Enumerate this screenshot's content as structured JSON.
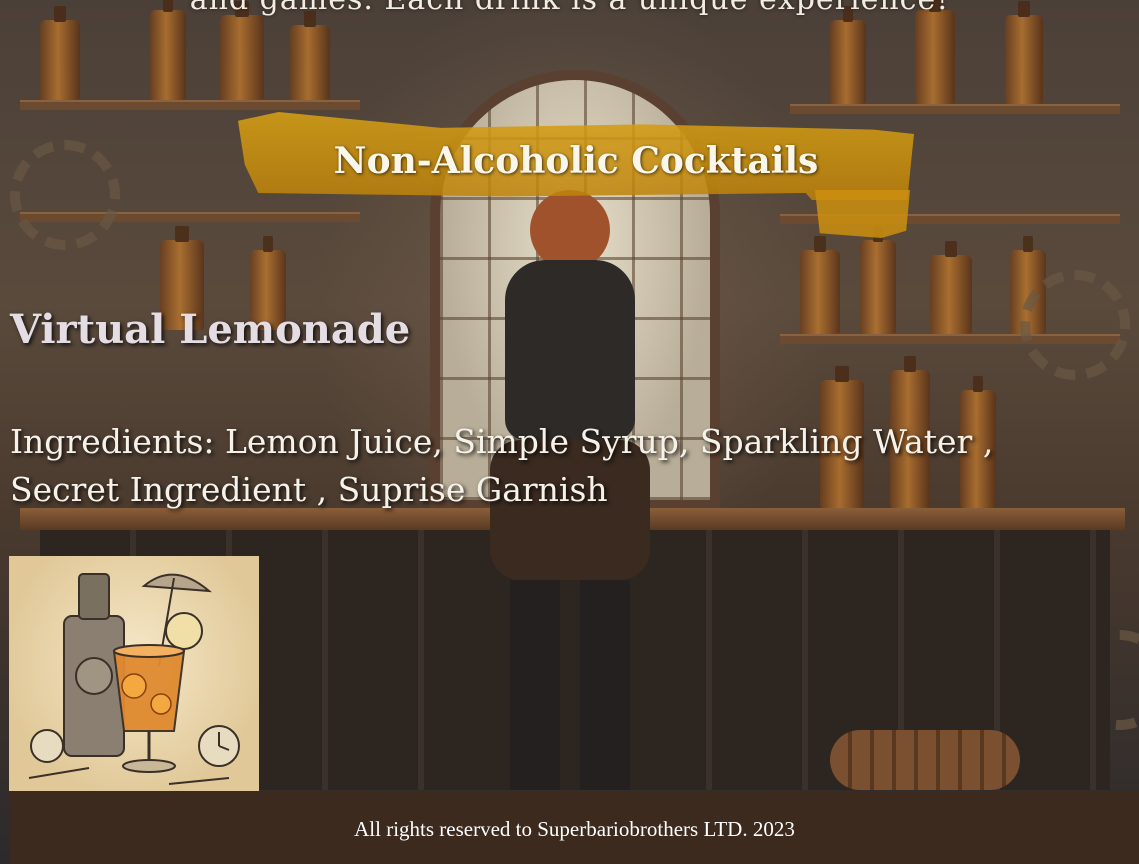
{
  "intro": {
    "text": "and games. Each drink is a unique experience!"
  },
  "section": {
    "title": "Non-Alcoholic Cocktails"
  },
  "drink": {
    "name": "Virtual Lemonade",
    "ingredients": "Ingredients: Lemon Juice, Simple Syrup, Sparkling Water , Secret Ingredient , Suprise Garnish",
    "image_icon": "steampunk-cocktail-illustration"
  },
  "footer": {
    "text": "All rights reserved to Superbariobrothers LTD. 2023"
  },
  "colors": {
    "banner": "#d6a014",
    "footer_bg": "#3b2a1d",
    "heading_text": "#e4dde4",
    "body_text": "#f6f2ea"
  }
}
